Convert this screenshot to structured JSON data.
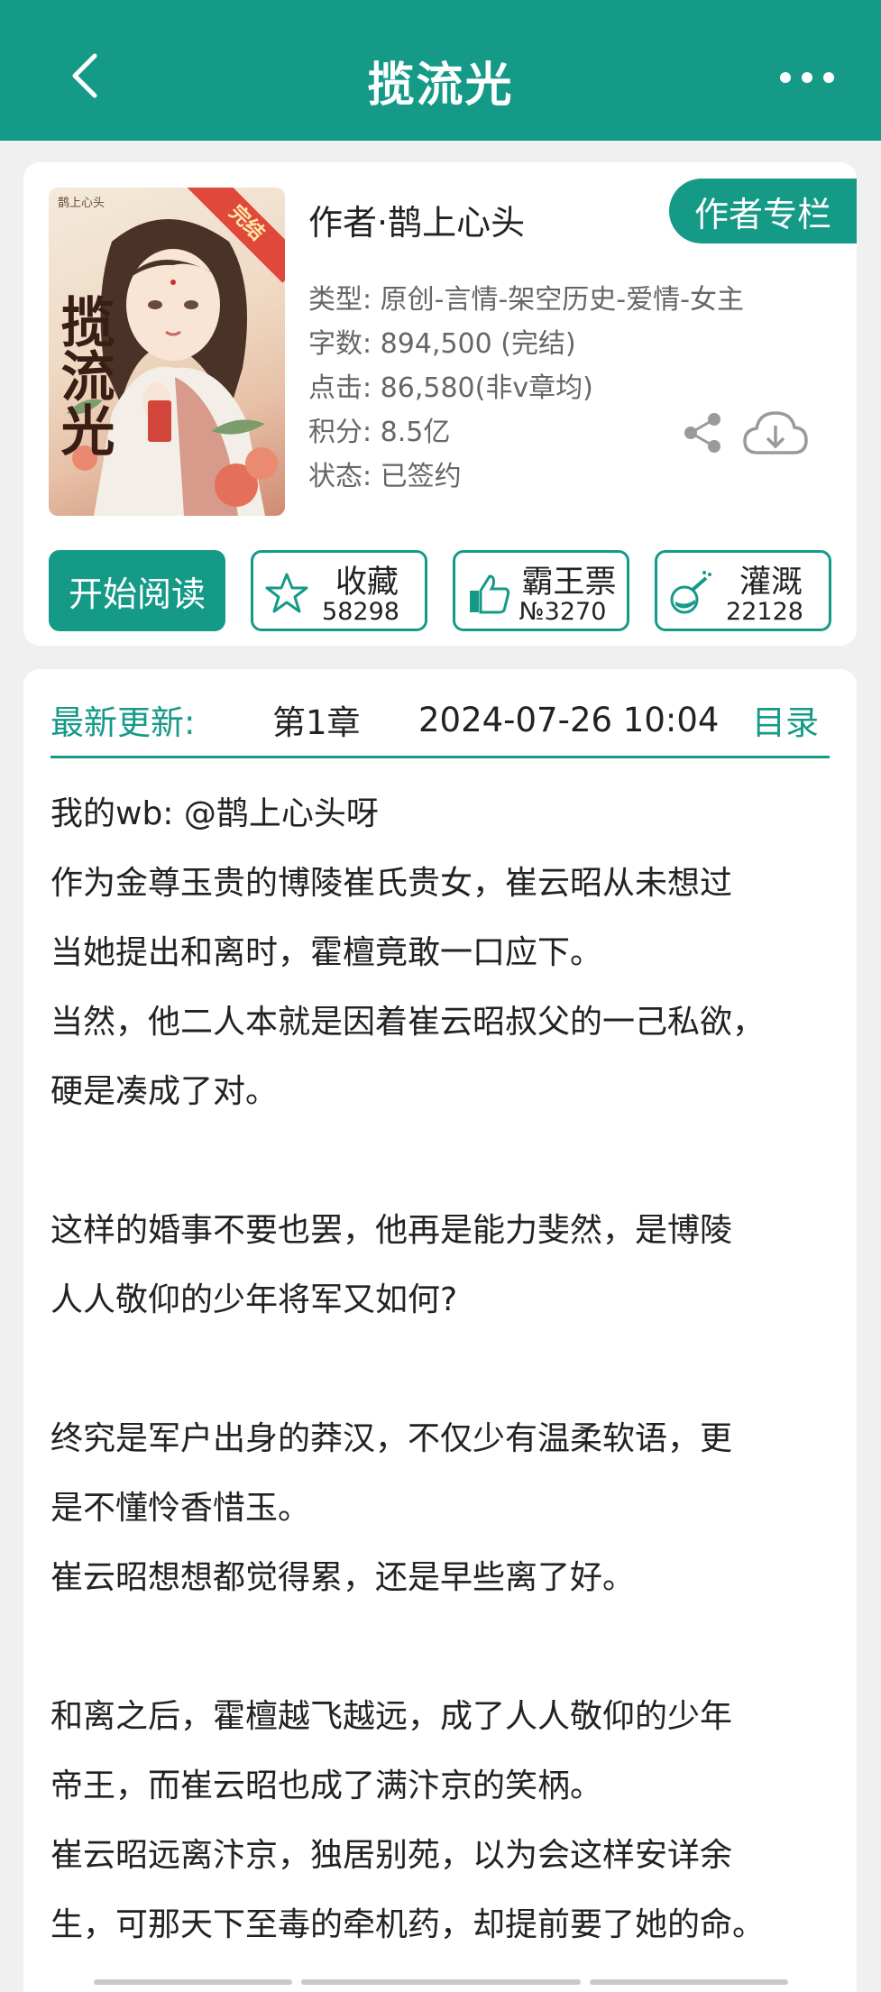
{
  "header": {
    "title": "揽流光",
    "back_icon": "chevron-left-icon",
    "more_icon": "more-dots-icon"
  },
  "book": {
    "cover": {
      "small_author": "鹊上心头",
      "ribbon": "完结",
      "title": "揽流光"
    },
    "author": "作者·鹊上心头",
    "author_column_button": "作者专栏",
    "meta": [
      "类型: 原创-言情-架空历史-爱情-女主",
      "字数: 894,500 (完结)",
      "点击: 86,580(非v章均)",
      "积分: 8.5亿",
      "状态: 已签约"
    ]
  },
  "actions": {
    "start_read": "开始阅读",
    "favorite": {
      "label": "收藏",
      "count": "58298",
      "icon": "star-icon"
    },
    "bawang": {
      "label": "霸王票",
      "count": "№3270",
      "icon": "thumbs-up-icon"
    },
    "irrigate": {
      "label": "灌溉",
      "count": "22128",
      "icon": "watering-flask-icon"
    }
  },
  "latest": {
    "label": "最新更新:",
    "chapter": "第1章",
    "time": "2024-07-26 10:04",
    "catalog": "目录"
  },
  "synopsis": [
    "我的wb: @鹊上心头呀",
    "作为金尊玉贵的博陵崔氏贵女，崔云昭从未想过",
    "当她提出和离时，霍檀竟敢一口应下。",
    "当然，他二人本就是因着崔云昭叔父的一己私欲，",
    "硬是凑成了对。",
    "",
    "这样的婚事不要也罢，他再是能力斐然，是博陵",
    "人人敬仰的少年将军又如何?",
    "",
    "终究是军户出身的莽汉，不仅少有温柔软语，更",
    "是不懂怜香惜玉。",
    "崔云昭想想都觉得累，还是早些离了好。",
    "",
    "和离之后，霍檀越飞越远，成了人人敬仰的少年",
    "帝王，而崔云昭也成了满汴京的笑柄。",
    "崔云昭远离汴京，独居别苑，以为会这样安详余",
    "生，可那天下至毒的牵机药，却提前要了她的命。"
  ],
  "colors": {
    "accent": "#159a88",
    "background": "#f0f0f0"
  }
}
